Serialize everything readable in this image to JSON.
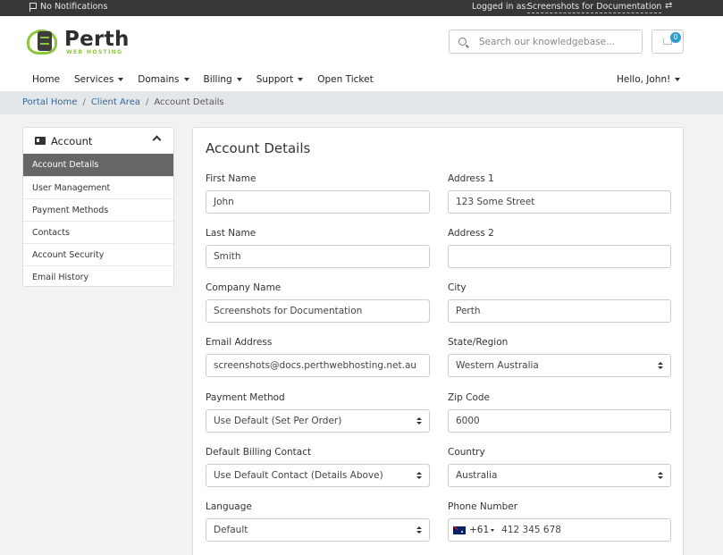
{
  "topbar": {
    "notifications": "No Notifications",
    "logged_in_as": "Logged in as:",
    "account_name": "Screenshots for Documentation"
  },
  "brand": {
    "title": "Perth",
    "subtitle": "WEB HOSTING",
    "accent_color": "#8cc63f"
  },
  "search": {
    "placeholder": "Search our knowledgebase..."
  },
  "cart": {
    "count": "0"
  },
  "nav": {
    "items": [
      "Home",
      "Services",
      "Domains",
      "Billing",
      "Support",
      "Open Ticket"
    ],
    "user": "Hello, John!"
  },
  "breadcrumb": {
    "items": [
      "Portal Home",
      "Client Area"
    ],
    "current": "Account Details"
  },
  "sidebar": {
    "title": "Account",
    "items": [
      "Account Details",
      "User Management",
      "Payment Methods",
      "Contacts",
      "Account Security",
      "Email History"
    ]
  },
  "form": {
    "title": "Account Details",
    "first_name": {
      "label": "First Name",
      "value": "John"
    },
    "last_name": {
      "label": "Last Name",
      "value": "Smith"
    },
    "company": {
      "label": "Company Name",
      "value": "Screenshots for Documentation"
    },
    "email": {
      "label": "Email Address",
      "value": "screenshots@docs.perthwebhosting.net.au"
    },
    "payment_method": {
      "label": "Payment Method",
      "value": "Use Default (Set Per Order)"
    },
    "billing_contact": {
      "label": "Default Billing Contact",
      "value": "Use Default Contact (Details Above)"
    },
    "language": {
      "label": "Language",
      "value": "Default"
    },
    "address1": {
      "label": "Address 1",
      "value": "123 Some Street"
    },
    "address2": {
      "label": "Address 2",
      "value": ""
    },
    "city": {
      "label": "City",
      "value": "Perth"
    },
    "state": {
      "label": "State/Region",
      "value": "Western Australia"
    },
    "zip": {
      "label": "Zip Code",
      "value": "6000"
    },
    "country": {
      "label": "Country",
      "value": "Australia"
    },
    "phone": {
      "label": "Phone Number",
      "dial_code": "+61",
      "value": "412 345 678"
    }
  }
}
